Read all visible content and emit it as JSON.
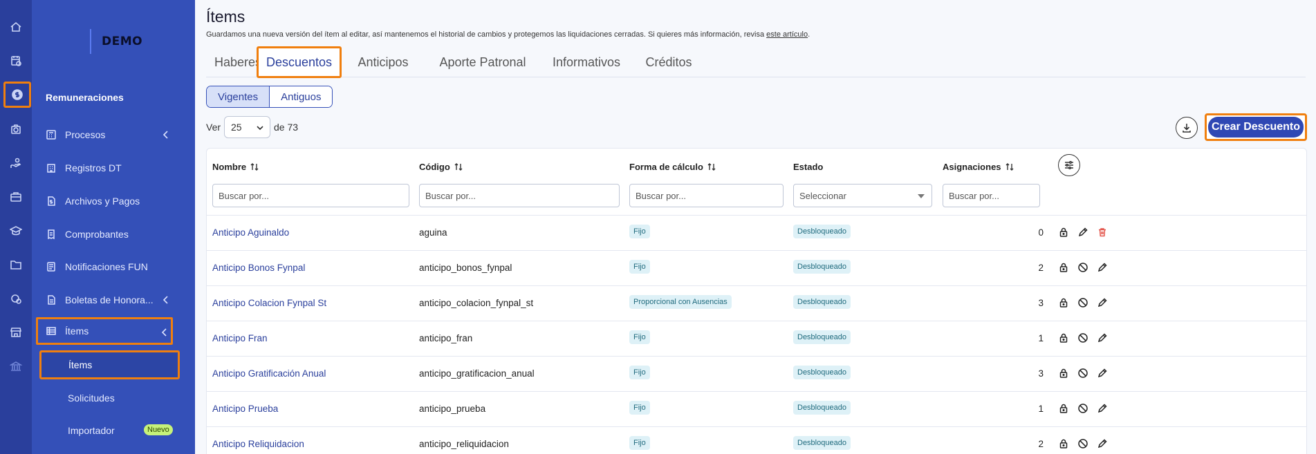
{
  "sidebar": {
    "logo": "DEMO",
    "section": "Remuneraciones",
    "items": [
      {
        "label": "Procesos"
      },
      {
        "label": "Registros DT"
      },
      {
        "label": "Archivos y Pagos"
      },
      {
        "label": "Comprobantes"
      },
      {
        "label": "Notificaciones FUN"
      },
      {
        "label": "Boletas de Honora..."
      },
      {
        "label": "Ítems"
      }
    ],
    "sub_items": [
      {
        "label": "Ítems"
      },
      {
        "label": "Solicitudes"
      },
      {
        "label": "Importador"
      }
    ],
    "badge": "Nuevo"
  },
  "page": {
    "title": "Ítems",
    "subtitle": "Guardamos una nueva versión del ítem al editar, así mantenemos el historial de cambios y protegemos las liquidaciones cerradas. Si quieres más información, revisa",
    "subtitle_link": "este artículo",
    "subtitle_end": "."
  },
  "tabs": [
    "Haberes",
    "Descuentos",
    "Anticipos",
    "Aporte Patronal",
    "Informativos",
    "Créditos"
  ],
  "segment": [
    "Vigentes",
    "Antiguos"
  ],
  "pager": {
    "prefix": "Ver",
    "value": "25",
    "suffix": "de 73"
  },
  "create_button": "Crear Descuento",
  "table": {
    "headers": [
      "Nombre",
      "Código",
      "Forma de cálculo",
      "Estado",
      "Asignaciones"
    ],
    "filters": [
      "Buscar por...",
      "Buscar por...",
      "Buscar por...",
      "Seleccionar",
      "Buscar por..."
    ],
    "rows": [
      {
        "name": "Anticipo Aguinaldo",
        "code": "aguina",
        "calc": "Fijo",
        "state": "Desbloqueado",
        "count": "0"
      },
      {
        "name": "Anticipo Bonos Fynpal",
        "code": "anticipo_bonos_fynpal",
        "calc": "Fijo",
        "state": "Desbloqueado",
        "count": "2"
      },
      {
        "name": "Anticipo Colacion Fynpal St",
        "code": "anticipo_colacion_fynpal_st",
        "calc": "Proporcional con Ausencias",
        "state": "Desbloqueado",
        "count": "3"
      },
      {
        "name": "Anticipo Fran",
        "code": "anticipo_fran",
        "calc": "Fijo",
        "state": "Desbloqueado",
        "count": "1"
      },
      {
        "name": "Anticipo Gratificación Anual",
        "code": "anticipo_gratificacion_anual",
        "calc": "Fijo",
        "state": "Desbloqueado",
        "count": "3"
      },
      {
        "name": "Anticipo Prueba",
        "code": "anticipo_prueba",
        "calc": "Fijo",
        "state": "Desbloqueado",
        "count": "1"
      },
      {
        "name": "Anticipo Reliquidacion",
        "code": "anticipo_reliquidacion",
        "calc": "Fijo",
        "state": "Desbloqueado",
        "count": "2"
      }
    ]
  },
  "colors": {
    "sidebar": "#3450b8",
    "rail": "#2a3f9c",
    "highlight": "#f07f0e",
    "primary": "#2f48b4"
  }
}
